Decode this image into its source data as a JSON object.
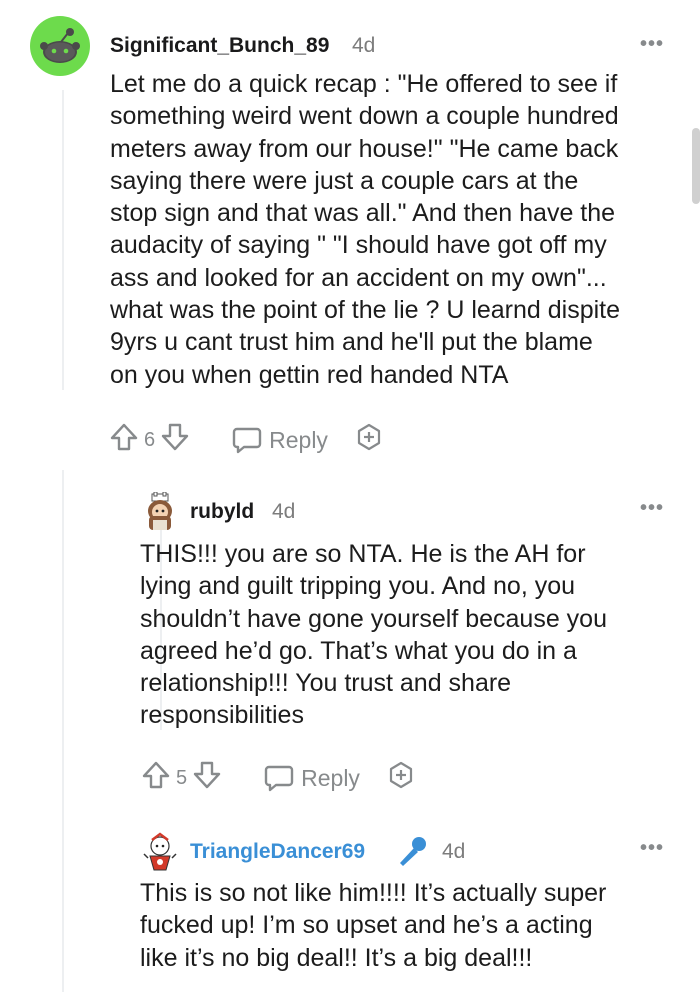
{
  "comments": [
    {
      "username": "Significant_Bunch_89",
      "time": "4d",
      "more": "•••",
      "lines": [
        "Let me do a quick recap : \"He offered to see if",
        "something weird went down a couple hundred",
        "meters away from our house!\" \"He came back",
        "saying there were just a couple cars at the",
        "stop sign and that was all.\" And then have the",
        "audacity of saying \" \"I should have got off my",
        "ass and looked for an accident on my own\"...",
        "what was the point of the lie ? U learnd dispite",
        "9yrs u cant trust him and he'll put the blame",
        "on you when gettin red handed NTA"
      ],
      "votes": "6",
      "reply_label": "Reply",
      "avatar_color": "#6ddb4c"
    },
    {
      "username": "rubyld",
      "time": "4d",
      "more": "•••",
      "lines": [
        "THIS!!! you are so NTA. He is the AH for",
        "lying and guilt tripping you. And no, you",
        "shouldn’t have gone yourself because you",
        "agreed he’d go. That’s what you do in a",
        "relationship!!! You trust and share",
        "responsibilities"
      ],
      "votes": "5",
      "reply_label": "Reply"
    },
    {
      "username": "TriangleDancer69",
      "time": "4d",
      "more": "•••",
      "username_color": "#3a8fd6",
      "lines": [
        "This is so not like him!!!! It’s actually super",
        "fucked up! I’m so upset and he’s a acting",
        "like it’s no big deal!! It’s a big deal!!!"
      ]
    }
  ],
  "icons": {
    "upvote": "upvote-arrow-icon",
    "downvote": "downvote-arrow-icon",
    "reply": "speech-bubble-icon",
    "award": "award-plus-icon",
    "mic": "microphone-icon"
  }
}
